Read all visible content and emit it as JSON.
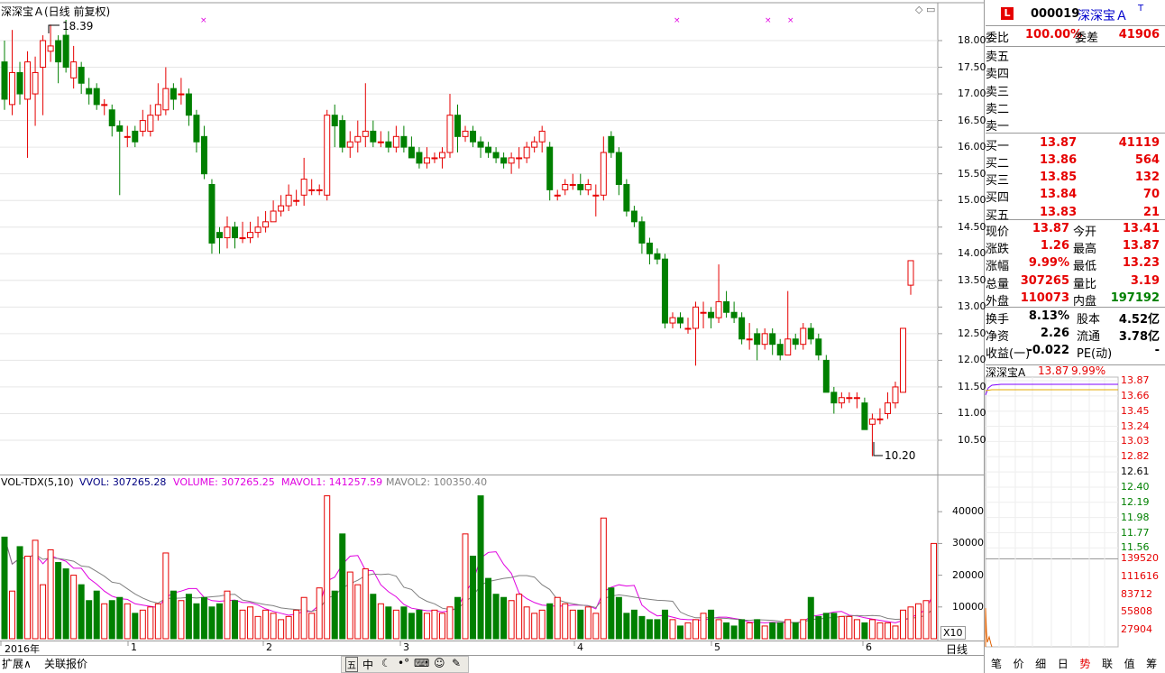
{
  "main_chart": {
    "title": "深深宝Ａ(日线 前复权)",
    "max_label": "18.39",
    "min_label": "10.20",
    "y_ticks": [
      "18.00",
      "17.50",
      "17.00",
      "16.50",
      "16.00",
      "15.50",
      "15.00",
      "14.50",
      "14.00",
      "13.50",
      "13.00",
      "12.50",
      "12.00",
      "11.50",
      "11.00",
      "10.50"
    ],
    "x_labels": [
      "2016年",
      "1",
      "2",
      "3",
      "4",
      "5",
      "6"
    ]
  },
  "vol_chart": {
    "indicator": "VOL-TDX(5,10)",
    "vvol": "VVOL: 307265.28",
    "volume": "VOLUME: 307265.25",
    "mavol1": "MAVOL1: 141257.59",
    "mavol2": "MAVOL2: 100350.40",
    "y_ticks": [
      "40000",
      "30000",
      "20000",
      "10000"
    ],
    "unit": "X10"
  },
  "colors": {
    "up": "#e60000",
    "down": "#008000",
    "ma1": "#e000e0",
    "ma2": "#808080",
    "price": "#8000ff"
  },
  "chart_data": [
    {
      "type": "candlestick",
      "title": "深深宝Ａ(日线 前复权)",
      "ylim": [
        10.0,
        18.5
      ],
      "x_labels": [
        "2016年",
        "1",
        "2",
        "3",
        "4",
        "5",
        "6"
      ],
      "candles": [
        [
          17.6,
          16.9,
          18.0,
          16.7
        ],
        [
          16.8,
          17.4,
          18.2,
          16.6
        ],
        [
          17.4,
          17.0,
          17.6,
          16.8
        ],
        [
          16.9,
          17.6,
          17.8,
          15.8
        ],
        [
          17.0,
          17.4,
          17.7,
          16.4
        ],
        [
          17.5,
          18.0,
          18.1,
          16.6
        ],
        [
          17.8,
          17.9,
          18.3,
          17.6
        ],
        [
          18.0,
          17.6,
          18.1,
          17.2
        ],
        [
          18.1,
          17.5,
          18.39,
          17.4
        ],
        [
          17.3,
          17.6,
          17.9,
          17.1
        ],
        [
          17.5,
          17.2,
          17.6,
          17.0
        ],
        [
          17.1,
          17.0,
          17.3,
          16.8
        ],
        [
          17.1,
          16.8,
          17.2,
          16.7
        ],
        [
          16.8,
          16.8,
          16.9,
          16.6
        ],
        [
          16.7,
          16.4,
          16.8,
          16.2
        ],
        [
          16.4,
          16.3,
          16.5,
          15.1
        ],
        [
          16.2,
          16.2,
          16.4,
          16.0
        ],
        [
          16.3,
          16.1,
          16.4,
          16.0
        ],
        [
          16.3,
          16.5,
          16.7,
          16.2
        ],
        [
          16.3,
          16.6,
          16.8,
          16.2
        ],
        [
          16.6,
          16.8,
          17.2,
          16.5
        ],
        [
          16.7,
          17.1,
          17.5,
          16.6
        ],
        [
          17.1,
          16.9,
          17.2,
          16.7
        ],
        [
          17.0,
          17.0,
          17.3,
          16.8
        ],
        [
          17.0,
          16.6,
          17.1,
          16.4
        ],
        [
          16.6,
          16.1,
          16.7,
          15.9
        ],
        [
          16.2,
          15.5,
          16.4,
          15.4
        ],
        [
          15.3,
          14.2,
          15.4,
          14.0
        ],
        [
          14.4,
          14.3,
          14.5,
          14.0
        ],
        [
          14.3,
          14.5,
          14.7,
          14.1
        ],
        [
          14.5,
          14.3,
          14.6,
          14.1
        ],
        [
          14.3,
          14.3,
          14.6,
          14.2
        ],
        [
          14.3,
          14.4,
          14.6,
          14.2
        ],
        [
          14.4,
          14.5,
          14.7,
          14.3
        ],
        [
          14.5,
          14.6,
          14.8,
          14.4
        ],
        [
          14.6,
          14.8,
          15.0,
          14.6
        ],
        [
          14.8,
          14.9,
          15.1,
          14.7
        ],
        [
          14.9,
          15.1,
          15.3,
          14.8
        ],
        [
          15.0,
          15.0,
          15.2,
          14.9
        ],
        [
          15.1,
          15.4,
          15.8,
          14.9
        ],
        [
          15.2,
          15.2,
          15.4,
          15.1
        ],
        [
          15.2,
          15.2,
          15.3,
          15.1
        ],
        [
          15.1,
          16.6,
          16.7,
          15.0
        ],
        [
          16.6,
          16.4,
          16.8,
          16.0
        ],
        [
          16.5,
          16.0,
          16.6,
          15.9
        ],
        [
          16.0,
          16.1,
          16.3,
          15.8
        ],
        [
          16.1,
          16.2,
          16.5,
          15.9
        ],
        [
          16.2,
          16.3,
          17.2,
          16.0
        ],
        [
          16.3,
          16.1,
          16.5,
          16.0
        ],
        [
          16.1,
          16.1,
          16.3,
          16.0
        ],
        [
          16.1,
          16.0,
          16.3,
          15.9
        ],
        [
          16.0,
          16.2,
          16.4,
          15.9
        ],
        [
          16.2,
          16.0,
          16.4,
          15.9
        ],
        [
          16.0,
          15.8,
          16.2,
          15.8
        ],
        [
          15.9,
          15.7,
          16.0,
          15.6
        ],
        [
          15.7,
          15.8,
          16.0,
          15.6
        ],
        [
          15.8,
          15.8,
          15.9,
          15.7
        ],
        [
          15.8,
          15.9,
          16.0,
          15.6
        ],
        [
          15.9,
          16.6,
          17.0,
          15.8
        ],
        [
          16.6,
          16.2,
          16.8,
          15.9
        ],
        [
          16.2,
          16.3,
          16.4,
          16.1
        ],
        [
          16.3,
          16.1,
          16.4,
          16.0
        ],
        [
          16.1,
          16.0,
          16.2,
          15.8
        ],
        [
          16.0,
          15.9,
          16.1,
          15.8
        ],
        [
          15.9,
          15.8,
          16.0,
          15.7
        ],
        [
          15.8,
          15.7,
          15.9,
          15.6
        ],
        [
          15.7,
          15.8,
          15.9,
          15.5
        ],
        [
          15.8,
          15.8,
          16.0,
          15.6
        ],
        [
          15.8,
          16.0,
          16.1,
          15.7
        ],
        [
          16.0,
          16.1,
          16.2,
          15.9
        ],
        [
          16.1,
          16.3,
          16.4,
          15.9
        ],
        [
          16.0,
          15.2,
          16.1,
          15.0
        ],
        [
          15.1,
          15.1,
          15.2,
          15.0
        ],
        [
          15.2,
          15.3,
          15.4,
          15.1
        ],
        [
          15.3,
          15.3,
          15.5,
          15.2
        ],
        [
          15.3,
          15.2,
          15.5,
          15.1
        ],
        [
          15.2,
          15.3,
          15.4,
          15.1
        ],
        [
          15.1,
          15.1,
          15.3,
          14.7
        ],
        [
          15.1,
          15.9,
          16.2,
          15.0
        ],
        [
          16.2,
          15.9,
          16.3,
          15.8
        ],
        [
          15.9,
          15.3,
          16.0,
          15.1
        ],
        [
          15.3,
          14.8,
          15.4,
          14.7
        ],
        [
          14.8,
          14.6,
          14.9,
          14.5
        ],
        [
          14.6,
          14.2,
          14.7,
          14.0
        ],
        [
          14.2,
          14.0,
          14.3,
          13.8
        ],
        [
          14.0,
          13.9,
          14.1,
          13.8
        ],
        [
          13.9,
          12.7,
          14.0,
          12.6
        ],
        [
          12.7,
          12.8,
          12.9,
          12.6
        ],
        [
          12.8,
          12.7,
          12.9,
          12.6
        ],
        [
          12.6,
          12.6,
          12.8,
          12.5
        ],
        [
          12.6,
          13.0,
          13.1,
          11.9
        ],
        [
          12.9,
          12.9,
          13.1,
          12.6
        ],
        [
          12.9,
          12.8,
          13.0,
          12.6
        ],
        [
          12.8,
          13.1,
          13.8,
          12.7
        ],
        [
          13.1,
          12.9,
          13.3,
          12.8
        ],
        [
          12.9,
          12.8,
          13.1,
          12.7
        ],
        [
          12.8,
          12.4,
          12.9,
          12.3
        ],
        [
          12.4,
          12.4,
          12.7,
          12.2
        ],
        [
          12.5,
          12.3,
          12.6,
          12.0
        ],
        [
          12.3,
          12.5,
          12.6,
          12.2
        ],
        [
          12.5,
          12.3,
          12.6,
          12.1
        ],
        [
          12.3,
          12.1,
          12.4,
          12.0
        ],
        [
          12.1,
          12.4,
          13.3,
          12.1
        ],
        [
          12.4,
          12.3,
          12.5,
          12.2
        ],
        [
          12.3,
          12.6,
          12.7,
          12.2
        ],
        [
          12.6,
          12.4,
          12.7,
          12.3
        ],
        [
          12.4,
          12.1,
          12.5,
          12.0
        ],
        [
          12.0,
          11.4,
          12.1,
          11.4
        ],
        [
          11.4,
          11.2,
          11.5,
          11.0
        ],
        [
          11.2,
          11.3,
          11.4,
          11.1
        ],
        [
          11.3,
          11.3,
          11.4,
          11.2
        ],
        [
          11.3,
          11.3,
          11.4,
          11.1
        ],
        [
          11.2,
          10.7,
          11.3,
          10.7
        ],
        [
          10.8,
          10.9,
          11.0,
          10.2
        ],
        [
          10.9,
          10.9,
          11.1,
          10.8
        ],
        [
          11.0,
          11.2,
          11.4,
          10.9
        ],
        [
          11.2,
          11.5,
          11.6,
          11.1
        ],
        [
          11.4,
          12.6,
          12.6,
          11.4
        ],
        [
          13.41,
          13.87,
          13.87,
          13.23
        ]
      ]
    },
    {
      "type": "bar",
      "title": "VOL-TDX(5,10)",
      "ylim": [
        0,
        50000
      ],
      "values": [
        32000,
        15000,
        29000,
        26000,
        31000,
        17000,
        28000,
        24000,
        22000,
        20000,
        17000,
        12000,
        15000,
        11000,
        12000,
        13000,
        11000,
        8000,
        9000,
        10000,
        11000,
        27000,
        15000,
        12000,
        14000,
        11000,
        13000,
        10000,
        11000,
        15000,
        12000,
        9000,
        10000,
        7000,
        9000,
        8000,
        6000,
        7000,
        9000,
        13000,
        8000,
        16000,
        45000,
        15000,
        33000,
        21000,
        17000,
        22000,
        14000,
        11000,
        10000,
        9000,
        10000,
        8000,
        9000,
        8000,
        9000,
        8000,
        10000,
        13000,
        33000,
        26000,
        45000,
        19000,
        14000,
        13000,
        12000,
        14000,
        10000,
        8000,
        9000,
        11000,
        13000,
        11000,
        9000,
        9000,
        10000,
        8000,
        38000,
        16000,
        13000,
        8000,
        9000,
        7000,
        6000,
        6000,
        9000,
        6000,
        4000,
        5000,
        6000,
        8000,
        9000,
        6000,
        5000,
        4000,
        6000,
        5000,
        6000,
        4000,
        5000,
        5000,
        6000,
        5000,
        6000,
        13000,
        7000,
        8000,
        8000,
        7000,
        7000,
        6000,
        5000,
        6000,
        5000,
        5000,
        4000,
        9000,
        10000,
        11000,
        12000,
        30000
      ]
    }
  ],
  "quote_panel": {
    "code": "000019",
    "name": "深深宝Ａ",
    "ratio_label": "委比",
    "ratio_value": "100.00%",
    "diff_label": "委差",
    "diff_value": "41906",
    "sell": [
      {
        "label": "卖五",
        "price": "",
        "vol": ""
      },
      {
        "label": "卖四",
        "price": "",
        "vol": ""
      },
      {
        "label": "卖三",
        "price": "",
        "vol": ""
      },
      {
        "label": "卖二",
        "price": "",
        "vol": ""
      },
      {
        "label": "卖一",
        "price": "",
        "vol": ""
      }
    ],
    "buy": [
      {
        "label": "买一",
        "price": "13.87",
        "vol": "41119"
      },
      {
        "label": "买二",
        "price": "13.86",
        "vol": "564"
      },
      {
        "label": "买三",
        "price": "13.85",
        "vol": "132"
      },
      {
        "label": "买四",
        "price": "13.84",
        "vol": "70"
      },
      {
        "label": "买五",
        "price": "13.83",
        "vol": "21"
      }
    ],
    "stats": [
      {
        "l1": "现价",
        "v1": "13.87",
        "c1": "red",
        "l2": "今开",
        "v2": "13.41",
        "c2": "red"
      },
      {
        "l1": "涨跌",
        "v1": "1.26",
        "c1": "red",
        "l2": "最高",
        "v2": "13.87",
        "c2": "red"
      },
      {
        "l1": "涨幅",
        "v1": "9.99%",
        "c1": "red",
        "l2": "最低",
        "v2": "13.23",
        "c2": "red"
      },
      {
        "l1": "总量",
        "v1": "307265",
        "c1": "red",
        "l2": "量比",
        "v2": "3.19",
        "c2": "red"
      },
      {
        "l1": "外盘",
        "v1": "110073",
        "c1": "red",
        "l2": "内盘",
        "v2": "197192",
        "c2": "grn"
      }
    ],
    "fin": [
      {
        "l1": "换手",
        "v1": "8.13%",
        "l2": "股本",
        "v2": "4.52亿"
      },
      {
        "l1": "净资",
        "v1": "2.26",
        "l2": "流通",
        "v2": "3.78亿"
      },
      {
        "l1": "收益(一)",
        "v1": "-0.022",
        "l2": "PE(动)",
        "v2": "-"
      }
    ]
  },
  "mini_chart": {
    "name": "深深宝A",
    "price": "13.87",
    "pct": "9.99%",
    "price_ticks": [
      "13.87",
      "13.66",
      "13.45",
      "13.24",
      "13.03",
      "12.82",
      "12.61",
      "12.40",
      "12.19",
      "11.98",
      "11.77",
      "11.56"
    ],
    "vol_ticks": [
      "139520",
      "111616",
      "83712",
      "55808",
      "27904"
    ]
  },
  "bottom_tabs": [
    "扩展∧",
    "关联报价"
  ],
  "period_label": "日线",
  "right_tabs": [
    "笔",
    "价",
    "细",
    "日",
    "势",
    "联",
    "值",
    "筹"
  ]
}
